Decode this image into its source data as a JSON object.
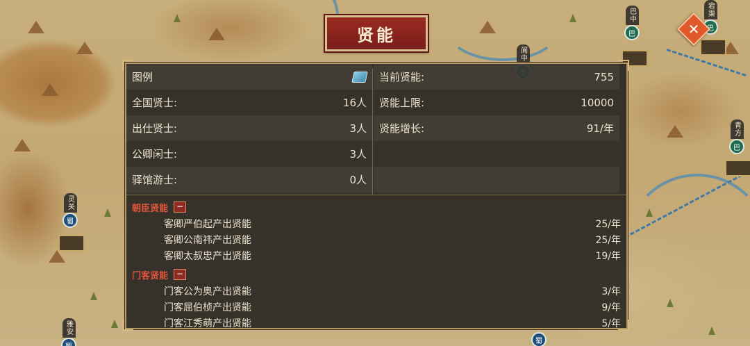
{
  "title": "贤能",
  "close_label": "✕",
  "map": {
    "cities": [
      {
        "name": "巴中",
        "badge": "巴",
        "kind": "ba"
      },
      {
        "name": "宕渠",
        "badge": "巴",
        "kind": "ba"
      },
      {
        "name": "阆中",
        "badge": "巴",
        "kind": "ba"
      },
      {
        "name": "青方",
        "badge": "巴",
        "kind": "ba"
      },
      {
        "name": "灵关",
        "badge": "蜀",
        "kind": "shu"
      },
      {
        "name": "雅安",
        "badge": "蜀",
        "kind": "shu"
      },
      {
        "name": "",
        "badge": "蜀",
        "kind": "shu"
      }
    ]
  },
  "legend": {
    "label": "图例",
    "icon": "book-icon"
  },
  "left_stats": [
    {
      "label": "全国贤士:",
      "value": "16人"
    },
    {
      "label": "出仕贤士:",
      "value": "3人"
    },
    {
      "label": "公卿闲士:",
      "value": "3人"
    },
    {
      "label": "驿馆游士:",
      "value": "0人"
    }
  ],
  "right_stats": [
    {
      "label": "当前贤能:",
      "value": "755"
    },
    {
      "label": "贤能上限:",
      "value": "10000"
    },
    {
      "label": "贤能增长:",
      "value": "91/年"
    }
  ],
  "sections": [
    {
      "title": "朝臣贤能",
      "toggle": "−",
      "items": [
        {
          "name": "客卿严伯起产出贤能",
          "rate": "25/年"
        },
        {
          "name": "客卿公南祎产出贤能",
          "rate": "25/年"
        },
        {
          "name": "客卿太叔忠产出贤能",
          "rate": "19/年"
        }
      ]
    },
    {
      "title": "门客贤能",
      "toggle": "−",
      "items": [
        {
          "name": "门客公为奥产出贤能",
          "rate": "3/年"
        },
        {
          "name": "门客屈伯桢产出贤能",
          "rate": "9/年"
        },
        {
          "name": "门客江秀萌产出贤能",
          "rate": "5/年"
        }
      ]
    }
  ],
  "colors": {
    "panel_bg": "#2b2824",
    "accent_red": "#e0553c",
    "title_plate": "#8a2620",
    "close_orange": "#e1582a"
  }
}
